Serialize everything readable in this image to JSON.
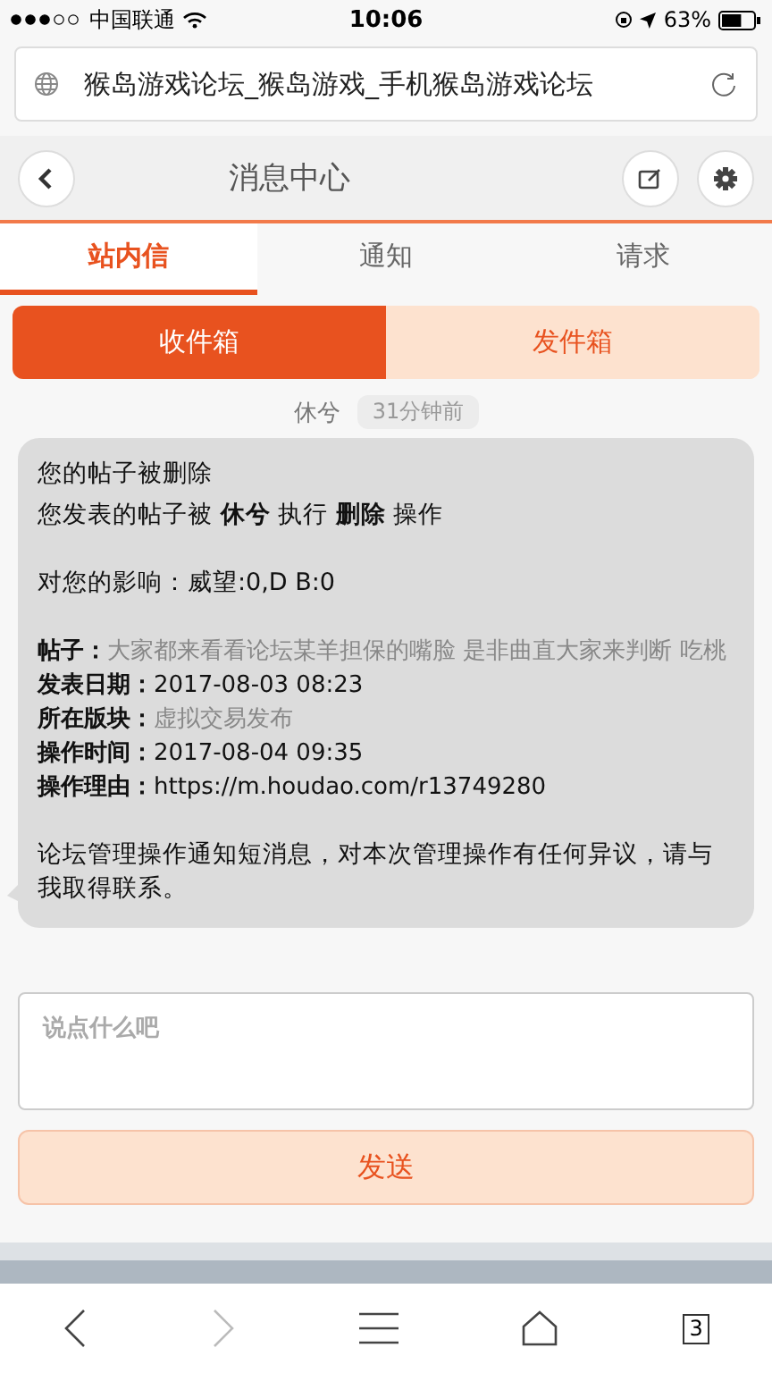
{
  "status_bar": {
    "carrier": "中国联通",
    "time": "10:06",
    "battery": "63%"
  },
  "address_bar": {
    "title": "猴岛游戏论坛_猴岛游戏_手机猴岛游戏论坛"
  },
  "header": {
    "title": "消息中心"
  },
  "tabs": [
    {
      "label": "站内信",
      "selected": true
    },
    {
      "label": "通知",
      "selected": false
    },
    {
      "label": "请求",
      "selected": false
    }
  ],
  "boxes": [
    {
      "label": "收件箱",
      "selected": true
    },
    {
      "label": "发件箱",
      "selected": false
    }
  ],
  "message": {
    "sender": "休兮",
    "time": "31分钟前",
    "subject": "您的帖子被删除",
    "action": "您发表的帖子被 **休兮** 执行 **删除** 操作",
    "impact": "对您的影响：威望:0,D B:0",
    "fields": [
      {
        "label": "帖子：",
        "value": "大家都来看看论坛某羊担保的嘴脸 是非曲直大家来判断 吃桃",
        "muted": true
      },
      {
        "label": "发表日期：",
        "value": "2017-08-03 08:23",
        "muted": false
      },
      {
        "label": "所在版块：",
        "value": "虚拟交易发布",
        "muted": true
      },
      {
        "label": "操作时间：",
        "value": "2017-08-04 09:35",
        "muted": false
      },
      {
        "label": "操作理由：",
        "value": "https://m.houdao.com/r13749280",
        "muted": false
      }
    ],
    "footer": "论坛管理操作通知短消息，对本次管理操作有任何异议，请与我取得联系。"
  },
  "reply": {
    "placeholder": "说点什么吧",
    "send": "发送"
  },
  "browser_toolbar": {
    "tab_count": "3"
  }
}
